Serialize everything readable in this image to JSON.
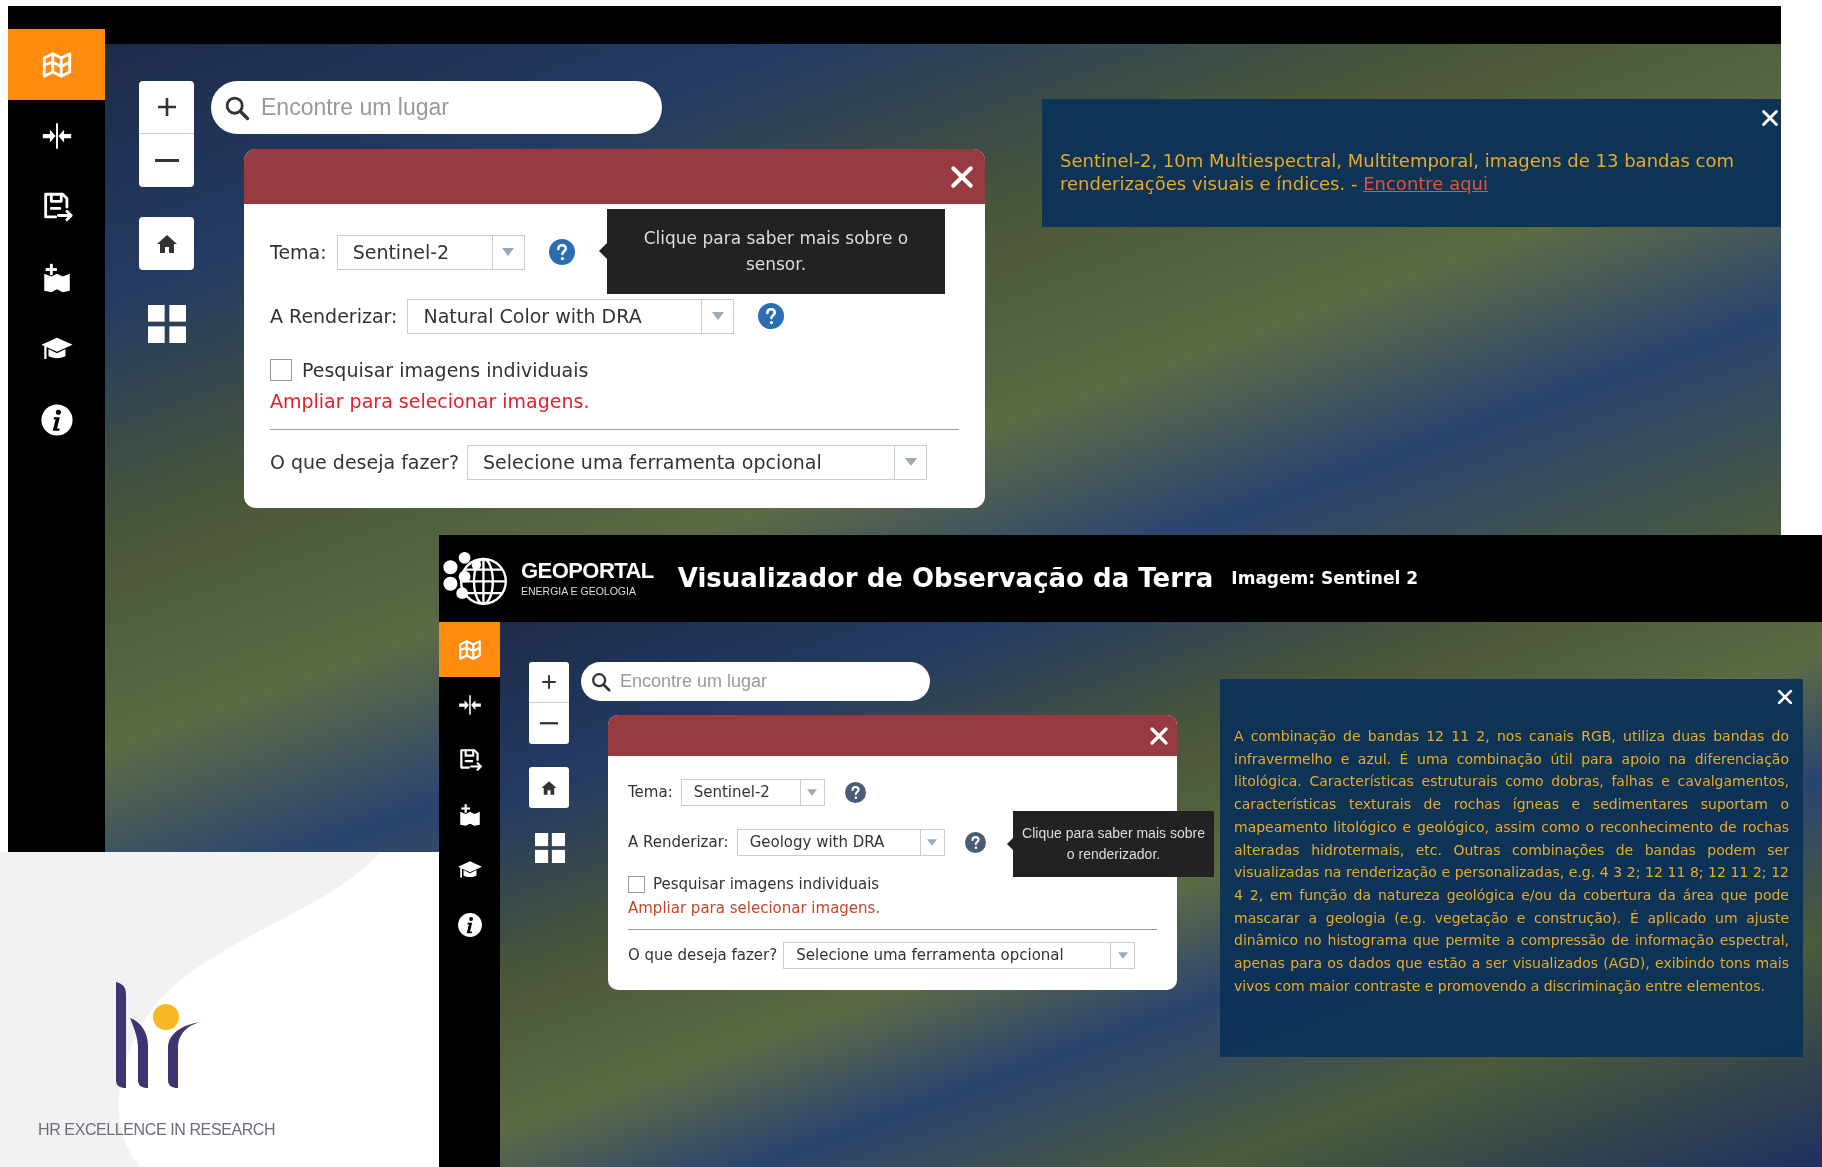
{
  "background_screen": {
    "sidebar": [
      {
        "selected": true
      },
      {
        "selected": false
      },
      {
        "selected": false
      },
      {
        "selected": false
      },
      {
        "selected": false
      },
      {
        "selected": false
      }
    ],
    "search": {
      "placeholder": "Encontre um lugar"
    },
    "dialog": {
      "theme_label": "Tema:",
      "theme_value": "Sentinel-2",
      "renderer_label": "A Renderizar:",
      "renderer_value": "Natural Color with DRA",
      "checkbox": {
        "label": "Pesquisar imagens individuais",
        "checked": false
      },
      "warning": "Ampliar para selecionar imagens.",
      "tool_label": "O que deseja fazer?",
      "tool_value": "Selecione uma ferramenta opcional"
    },
    "theme_help_tooltip": {
      "text": "Clique para saber mais sobre o sensor."
    },
    "info_panel": {
      "text": "Sentinel-2, 10m Multiespectral, Multitemporal, imagens de 13 bandas com renderizações visuais e índices. -",
      "link": "Encontre aqui"
    }
  },
  "foreground_screen": {
    "header": {
      "logo_title": "GEOPORTAL",
      "logo_subtitle": "ENERGIA E GEOLOGIA",
      "title": "Visualizador de Observação da Terra",
      "subtitle": "Imagem: Sentinel 2"
    },
    "sidebar": [
      {
        "selected": true
      },
      {
        "selected": false
      },
      {
        "selected": false
      },
      {
        "selected": false
      },
      {
        "selected": false
      },
      {
        "selected": false
      }
    ],
    "search": {
      "placeholder": "Encontre um lugar"
    },
    "dialog": {
      "theme_label": "Tema:",
      "theme_value": "Sentinel-2",
      "renderer_label": "A Renderizar:",
      "renderer_value": "Geology with DRA",
      "checkbox": {
        "label": "Pesquisar imagens individuais",
        "checked": false
      },
      "warning": "Ampliar para selecionar imagens.",
      "tool_label": "O que deseja fazer?",
      "tool_value": "Selecione uma ferramenta opcional"
    },
    "renderer_help_tooltip": {
      "text": "Clique para saber mais sobre o renderizador."
    },
    "info_panel": {
      "text": "A combinação de bandas 12 11 2, nos canais RGB, utiliza duas bandas do infravermelho e azul. É uma combinação útil para apoio na diferenciação litológica. Características estruturais como dobras, falhas e cavalgamentos, características texturais de rochas ígneas e sedimentares suportam o mapeamento litológico e geológico, assim como o reconhecimento de rochas alteradas hidrotermais, etc. Outras combinações de bandas podem ser visualizadas na renderização e personalizadas, e.g. 4 3 2; 12 11 8; 12 11 2; 12 4 2, em função da natureza geológica e/ou da cobertura da área que pode mascarar a geologia (e.g. vegetação e construção). É aplicado um ajuste dinâmico no histograma que permite a compressão de informação espectral, apenas para os dados que estão a ser visualizados (AGD), exibindo tons mais vivos com maior contraste e promovendo a discriminação entre elementos."
    }
  },
  "badge": {
    "text": "HR EXCELLENCE IN RESEARCH"
  }
}
